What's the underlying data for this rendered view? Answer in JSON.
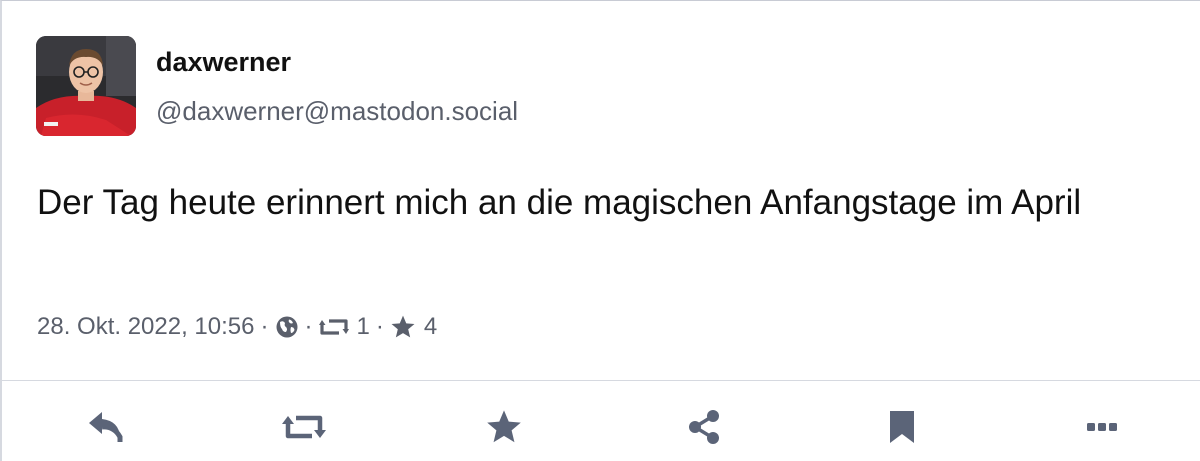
{
  "author": {
    "display_name": "daxwerner",
    "handle": "@daxwerner@mastodon.social"
  },
  "post": {
    "text": "Der Tag heute erinnert mich an die magischen Anfangstage im April",
    "timestamp": "28. Okt. 2022, 10:56",
    "visibility_icon": "globe-icon",
    "boost_count": "1",
    "favourite_count": "4",
    "separator": "·"
  },
  "action_bar": {
    "items": [
      "reply-icon",
      "boost-icon",
      "favourite-icon",
      "share-icon",
      "bookmark-icon",
      "more-icon"
    ]
  },
  "colors": {
    "text": "#111111",
    "muted": "#5a5f6b",
    "icon": "#5b6478",
    "border": "#d6d9e0"
  }
}
